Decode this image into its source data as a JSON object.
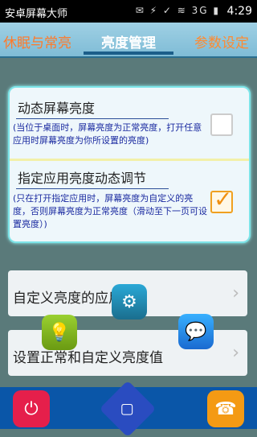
{
  "status_bar": {
    "app_title": "安卓屏幕大师",
    "icons_text": "✉ ⚡ ✓ ≋ 3G ▮",
    "time": "4:29"
  },
  "tabs": [
    {
      "label": "休眠与常亮"
    },
    {
      "label": "亮度管理"
    },
    {
      "label": "参数设定"
    }
  ],
  "settings": {
    "dynamic_brightness": {
      "title": "动态屏幕亮度",
      "description": "(当位于桌面时，屏幕亮度为正常亮度，打开任意应用时屏幕亮度为你所设置的亮度)",
      "checked": false
    },
    "app_brightness": {
      "title": "指定应用亮度动态调节",
      "description": "(只在打开指定应用时，屏幕亮度为自定义的亮度，否则屏幕亮度为正常亮度（滑动至下一页可设置亮度）)",
      "checked": true
    }
  },
  "menus": [
    {
      "label": "自定义亮度的应用"
    },
    {
      "label": "设置正常和自定义亮度值"
    }
  ],
  "icons": {
    "float_gear": "⚙",
    "float_bulb": "💡",
    "float_chat": "💬",
    "power": "⏻",
    "diamond": "▢",
    "phone": "☎",
    "arrow": "›"
  }
}
